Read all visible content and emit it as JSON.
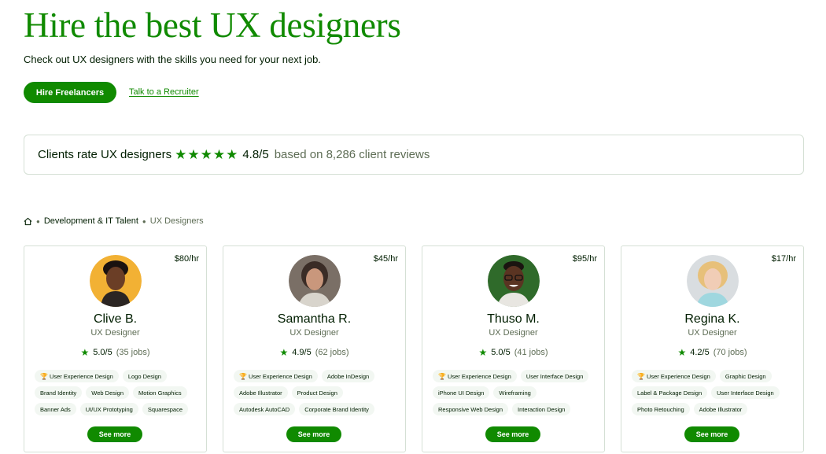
{
  "hero": {
    "title": "Hire the best UX designers",
    "subtitle": "Check out UX designers with the skills you need for your next job.",
    "hire_button": "Hire Freelancers",
    "recruiter_link": "Talk to a Recruiter"
  },
  "rating": {
    "label": "Clients rate UX designers",
    "stars": 5,
    "score": "4.8/5",
    "reviews": "based on 8,286 client reviews"
  },
  "breadcrumb": {
    "home_icon": "home-icon",
    "category": "Development & IT Talent",
    "current": "UX Designers"
  },
  "colors": {
    "accent": "#108a00",
    "text": "#001e00",
    "muted": "#5e6d55",
    "border": "#d5e0d5",
    "chip": "#f2f7f2"
  },
  "freelancers": [
    {
      "rate": "$80/hr",
      "name": "Clive B.",
      "role": "UX Designer",
      "score": "5.0/5",
      "jobs": "(35 jobs)",
      "avatar_bg": "#f2b134",
      "skills": [
        "User Experience Design",
        "Logo Design",
        "Brand Identity",
        "Web Design",
        "Motion Graphics",
        "Banner Ads",
        "UI/UX Prototyping",
        "Squarespace"
      ],
      "see_more": "See more"
    },
    {
      "rate": "$45/hr",
      "name": "Samantha R.",
      "role": "UX Designer",
      "score": "4.9/5",
      "jobs": "(62 jobs)",
      "avatar_bg": "#7a6f66",
      "skills": [
        "User Experience Design",
        "Adobe InDesign",
        "Adobe Illustrator",
        "Product Design",
        "Autodesk AutoCAD",
        "Corporate Brand Identity"
      ],
      "see_more": "See more"
    },
    {
      "rate": "$95/hr",
      "name": "Thuso M.",
      "role": "UX Designer",
      "score": "5.0/5",
      "jobs": "(41 jobs)",
      "avatar_bg": "#2f6a2a",
      "skills": [
        "User Experience Design",
        "User Interface Design",
        "iPhone UI Design",
        "Wireframing",
        "Responsive Web Design",
        "Interaction Design"
      ],
      "see_more": "See more"
    },
    {
      "rate": "$17/hr",
      "name": "Regina K.",
      "role": "UX Designer",
      "score": "4.2/5",
      "jobs": "(70 jobs)",
      "avatar_bg": "#d9dde0",
      "skills": [
        "User Experience Design",
        "Graphic Design",
        "Label & Package Design",
        "User Interface Design",
        "Photo Retouching",
        "Adobe Illustrator"
      ],
      "see_more": "See more"
    }
  ]
}
